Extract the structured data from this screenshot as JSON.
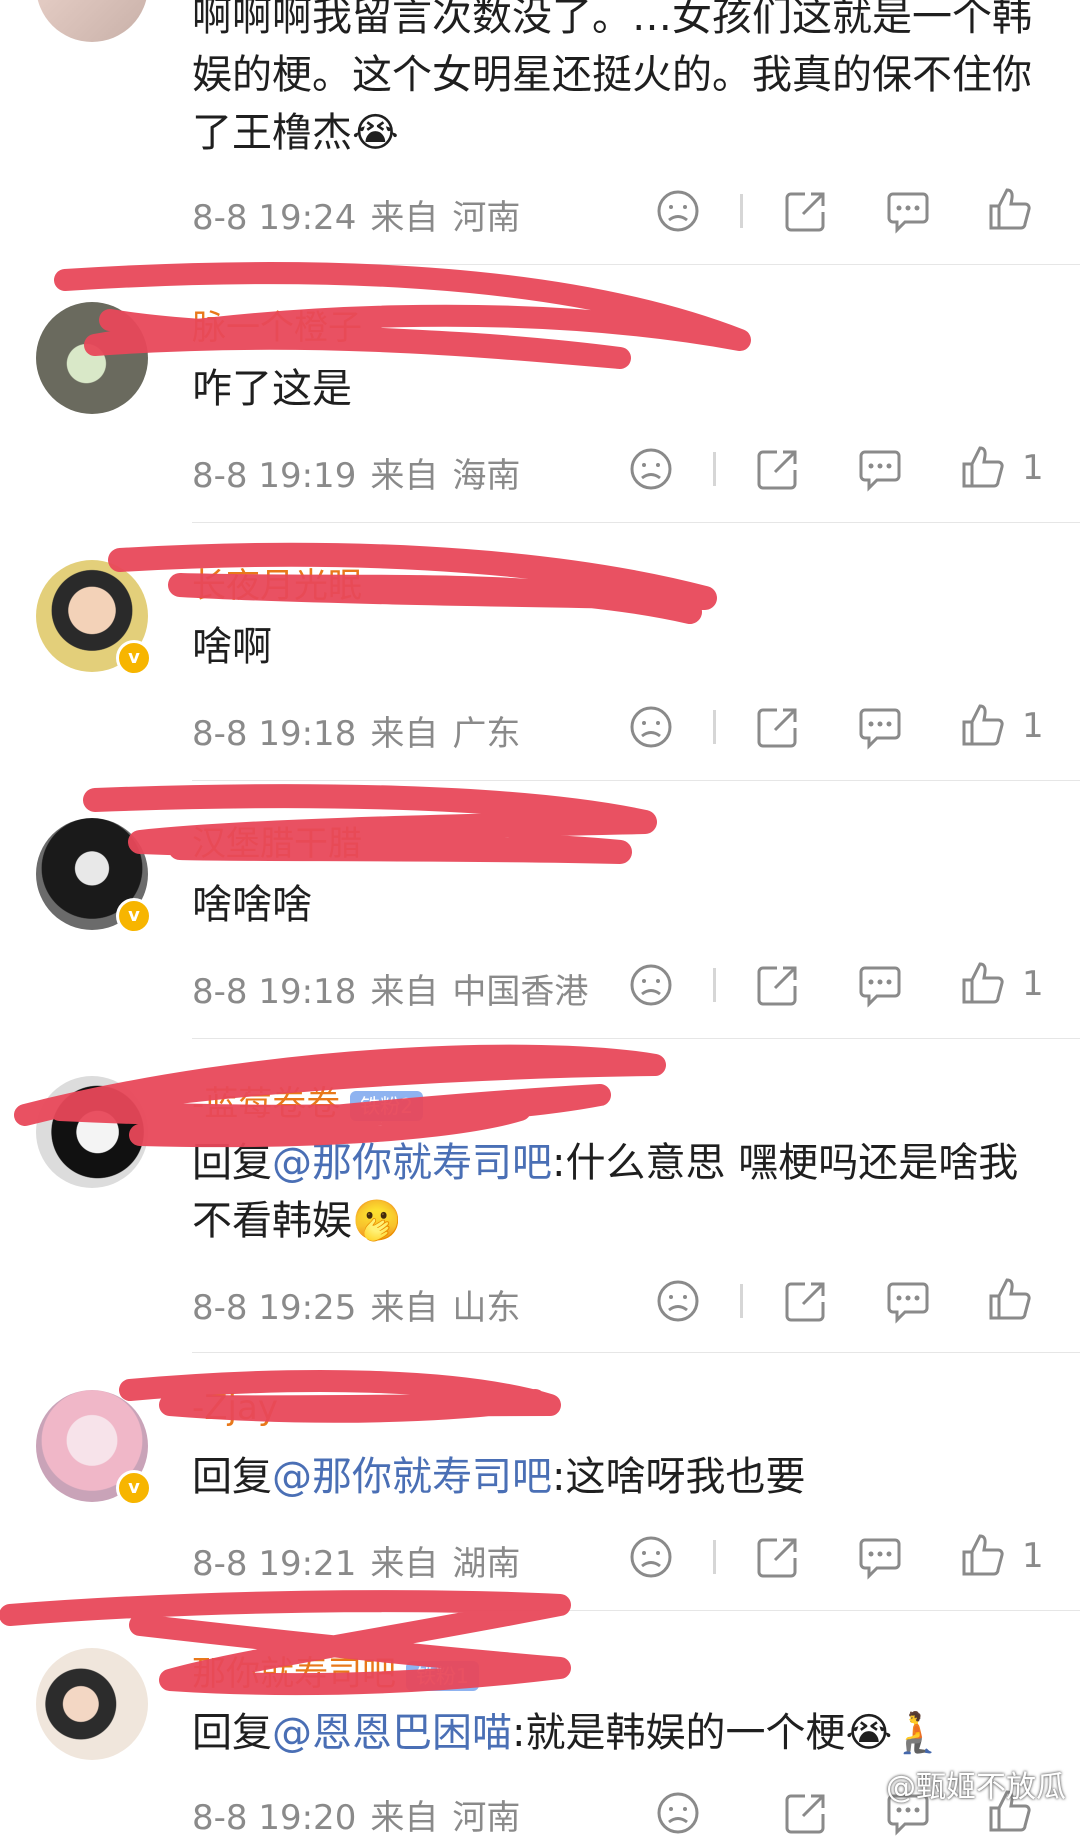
{
  "comments": [
    {
      "text": "啊啊啊我留言次数没了。…女孩们这就是一个韩娱的梗。这个女明星还挺火的。我真的保不住你了王橹杰😭",
      "time": "8-8 19:24",
      "from": "来自",
      "location": "河南",
      "likes": ""
    },
    {
      "username": "脉一个橙子",
      "text": "咋了这是",
      "time": "8-8 19:19",
      "from": "来自",
      "location": "海南",
      "likes": "1"
    },
    {
      "username": "长夜月光眠",
      "text": "啥啊",
      "time": "8-8 19:18",
      "from": "来自",
      "location": "广东",
      "likes": "1"
    },
    {
      "username": "汉堡腊干腊",
      "text": "啥啥啥",
      "time": "8-8 19:18",
      "from": "来自",
      "location": "中国香港",
      "likes": "1"
    },
    {
      "username": "-蓝莓卷卷",
      "badge": "铁粉2",
      "reply_prefix": "回复",
      "mention": "@那你就寿司吧",
      "text": ":什么意思 嘿梗吗还是啥我不看韩娱🫢",
      "time": "8-8 19:25",
      "from": "来自",
      "location": "山东",
      "likes": ""
    },
    {
      "username": "-Zjay",
      "reply_prefix": "回复",
      "mention": "@那你就寿司吧",
      "text": ":这啥呀我也要",
      "time": "8-8 19:21",
      "from": "来自",
      "location": "湖南",
      "likes": "1"
    },
    {
      "username": "那你就寿司吧",
      "badge": "铁粉1",
      "reply_prefix": "回复",
      "mention": "@恩恩巴困喵",
      "text": ":就是韩娱的一个梗😭🧎",
      "time": "8-8 19:20",
      "from": "来自",
      "location": "河南",
      "likes": ""
    }
  ],
  "watermark": "@甄姬不放瓜",
  "colors": {
    "scribble": "#e8485a",
    "mention": "#4a6fb5",
    "username": "#e8781a",
    "meta": "#8a8a8a"
  }
}
